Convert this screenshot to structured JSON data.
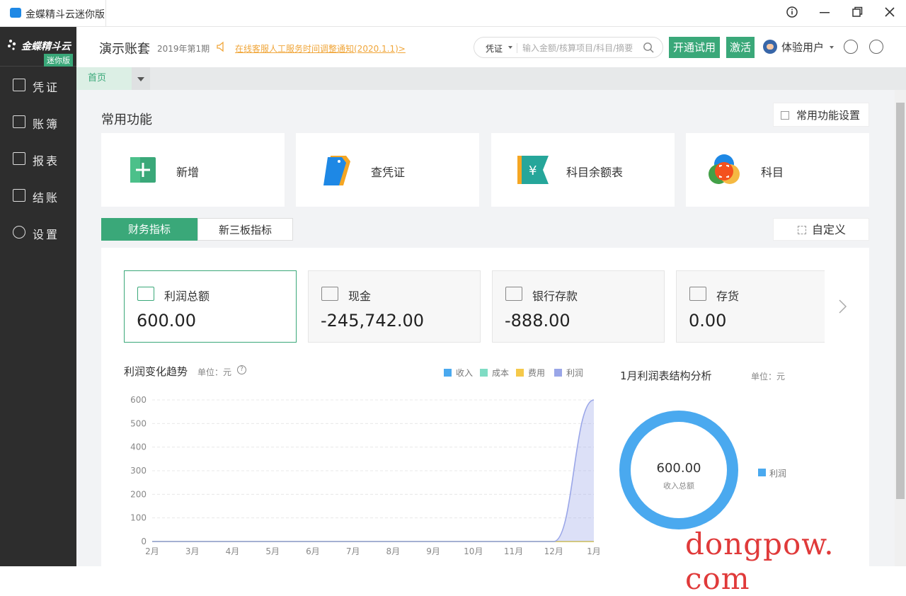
{
  "window": {
    "title": "金蝶精斗云迷你版",
    "controls": [
      "info-icon",
      "minimize-icon",
      "restore-icon",
      "close-icon"
    ]
  },
  "sidebar": {
    "brand": "金蝶精斗云",
    "badge": "迷你版",
    "items": [
      {
        "label": "凭证",
        "icon": "voucher-icon"
      },
      {
        "label": "账簿",
        "icon": "ledger-icon"
      },
      {
        "label": "报表",
        "icon": "report-icon"
      },
      {
        "label": "结账",
        "icon": "close-account-icon"
      },
      {
        "label": "设置",
        "icon": "settings-icon"
      }
    ]
  },
  "header": {
    "account_title": "演示账套",
    "period": "2019年第1期",
    "notice": "在线客服人工服务时间调整通知(2020.1.1)>",
    "search": {
      "type": "凭证",
      "placeholder": "输入金额/核算项目/科目/摘要"
    },
    "trial_button": "开通试用",
    "activate_button": "激活",
    "user_name": "体验用户"
  },
  "tabs": {
    "home": "首页"
  },
  "main": {
    "section_title": "常用功能",
    "settings_button": "常用功能设置",
    "functions": [
      {
        "label": "新增",
        "icon": "add-icon"
      },
      {
        "label": "查凭证",
        "icon": "find-voucher-icon"
      },
      {
        "label": "科目余额表",
        "icon": "balance-sheet-icon"
      },
      {
        "label": "科目",
        "icon": "account-subject-icon"
      }
    ],
    "indicator_tabs": [
      "财务指标",
      "新三板指标"
    ],
    "custom_button": "自定义",
    "metrics": [
      {
        "label": "利润总额",
        "value": "600.00",
        "icon": "profit-icon"
      },
      {
        "label": "现金",
        "value": "-245,742.00",
        "icon": "cash-icon"
      },
      {
        "label": "银行存款",
        "value": "-888.00",
        "icon": "bank-icon"
      },
      {
        "label": "存货",
        "value": "0.00",
        "icon": "inventory-icon"
      }
    ]
  },
  "colors": {
    "accent": "#3aa879",
    "sidebar_bg": "#2d2d2d",
    "notice": "#f0a63a",
    "income": "#4aa9ef",
    "cost": "#7fdcc4",
    "expense": "#f5c94a",
    "profit": "#9aa6e8"
  },
  "chart_data": [
    {
      "type": "area",
      "title": "利润变化趋势",
      "unit": "单位：元",
      "categories": [
        "2月",
        "3月",
        "4月",
        "5月",
        "6月",
        "7月",
        "8月",
        "9月",
        "10月",
        "11月",
        "12月",
        "1月"
      ],
      "yticks": [
        "0",
        "100",
        "200",
        "300",
        "400",
        "500",
        "600"
      ],
      "ylim": [
        0,
        600
      ],
      "grid": true,
      "legend_position": "top-right",
      "series": [
        {
          "name": "收入",
          "values": [
            0,
            0,
            0,
            0,
            0,
            0,
            0,
            0,
            0,
            0,
            0,
            0
          ]
        },
        {
          "name": "成本",
          "values": [
            0,
            0,
            0,
            0,
            0,
            0,
            0,
            0,
            0,
            0,
            0,
            0
          ]
        },
        {
          "name": "费用",
          "values": [
            0,
            0,
            0,
            0,
            0,
            0,
            0,
            0,
            0,
            0,
            0,
            0
          ]
        },
        {
          "name": "利润",
          "values": [
            0,
            0,
            0,
            0,
            0,
            0,
            0,
            0,
            0,
            0,
            0,
            600
          ]
        }
      ]
    },
    {
      "type": "pie",
      "title": "1月利润表结构分析",
      "unit": "单位：元",
      "center_value": "600.00",
      "center_label": "收入总额",
      "legend_position": "right",
      "slices": [
        {
          "name": "利润",
          "value": 600
        }
      ]
    }
  ],
  "watermark": "dongpow. com"
}
